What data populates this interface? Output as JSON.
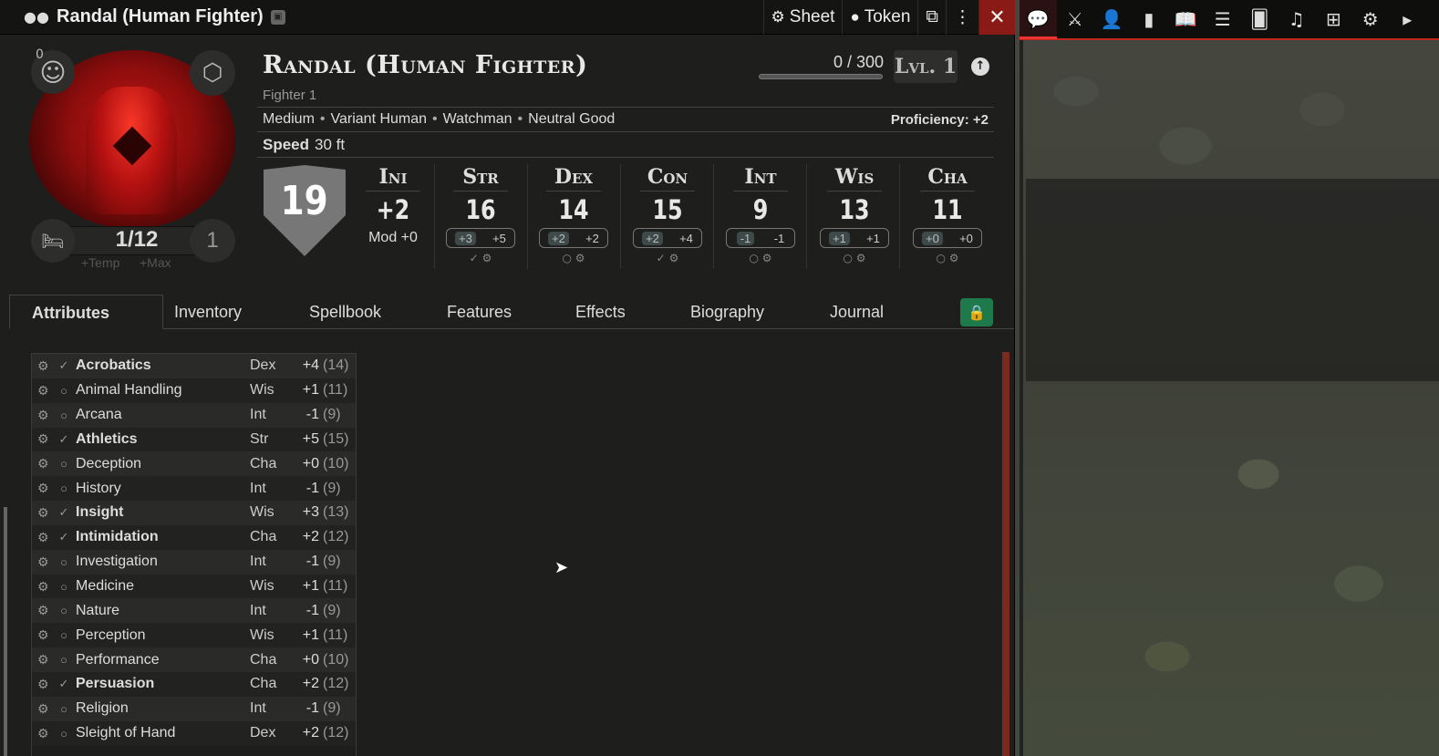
{
  "window": {
    "title": "Randal (Human Fighter)",
    "sheet_label": "Sheet",
    "token_label": "Token"
  },
  "character": {
    "name": "Randal (Human Fighter)",
    "class_level": "Fighter 1",
    "xp_text": "0 / 300",
    "level_label": "Lvl. 1",
    "info": [
      "Medium",
      "Variant Human",
      "Watchman",
      "Neutral Good"
    ],
    "proficiency": "Proficiency: +2",
    "speed_label": "Speed",
    "speed_value": "30 ft",
    "ac": "19",
    "hp": "1/12",
    "hit_dice": "1",
    "inspiration": "0",
    "temp_label": "+Temp",
    "max_label": "+Max"
  },
  "initiative": {
    "abbr": "Ini",
    "value": "+2",
    "mod_text": "Mod +0"
  },
  "abilities": [
    {
      "abbr": "Str",
      "score": "16",
      "mod": "+3",
      "save": "+5",
      "save_flag": "✓"
    },
    {
      "abbr": "Dex",
      "score": "14",
      "mod": "+2",
      "save": "+2",
      "save_flag": "○"
    },
    {
      "abbr": "Con",
      "score": "15",
      "mod": "+2",
      "save": "+4",
      "save_flag": "✓"
    },
    {
      "abbr": "Int",
      "score": "9",
      "mod": "-1",
      "save": "-1",
      "save_flag": "○"
    },
    {
      "abbr": "Wis",
      "score": "13",
      "mod": "+1",
      "save": "+1",
      "save_flag": "○"
    },
    {
      "abbr": "Cha",
      "score": "11",
      "mod": "+0",
      "save": "+0",
      "save_flag": "○"
    }
  ],
  "tabs": [
    "Attributes",
    "Inventory",
    "Spellbook",
    "Features",
    "Effects",
    "Biography",
    "Journal"
  ],
  "skills": [
    {
      "name": "Acrobatics",
      "abil": "Dex",
      "mod": "+4",
      "passive": "(14)",
      "prof": true
    },
    {
      "name": "Animal Handling",
      "abil": "Wis",
      "mod": "+1",
      "passive": "(11)",
      "prof": false
    },
    {
      "name": "Arcana",
      "abil": "Int",
      "mod": "-1",
      "passive": "(9)",
      "prof": false
    },
    {
      "name": "Athletics",
      "abil": "Str",
      "mod": "+5",
      "passive": "(15)",
      "prof": true
    },
    {
      "name": "Deception",
      "abil": "Cha",
      "mod": "+0",
      "passive": "(10)",
      "prof": false
    },
    {
      "name": "History",
      "abil": "Int",
      "mod": "-1",
      "passive": "(9)",
      "prof": false
    },
    {
      "name": "Insight",
      "abil": "Wis",
      "mod": "+3",
      "passive": "(13)",
      "prof": true
    },
    {
      "name": "Intimidation",
      "abil": "Cha",
      "mod": "+2",
      "passive": "(12)",
      "prof": true
    },
    {
      "name": "Investigation",
      "abil": "Int",
      "mod": "-1",
      "passive": "(9)",
      "prof": false
    },
    {
      "name": "Medicine",
      "abil": "Wis",
      "mod": "+1",
      "passive": "(11)",
      "prof": false
    },
    {
      "name": "Nature",
      "abil": "Int",
      "mod": "-1",
      "passive": "(9)",
      "prof": false
    },
    {
      "name": "Perception",
      "abil": "Wis",
      "mod": "+1",
      "passive": "(11)",
      "prof": false
    },
    {
      "name": "Performance",
      "abil": "Cha",
      "mod": "+0",
      "passive": "(10)",
      "prof": false
    },
    {
      "name": "Persuasion",
      "abil": "Cha",
      "mod": "+2",
      "passive": "(12)",
      "prof": true
    },
    {
      "name": "Religion",
      "abil": "Int",
      "mod": "-1",
      "passive": "(9)",
      "prof": false
    },
    {
      "name": "Sleight of Hand",
      "abil": "Dex",
      "mod": "+2",
      "passive": "(12)",
      "prof": false
    }
  ],
  "sidebar_icons": [
    "chat-icon",
    "combat-icon",
    "actors-icon",
    "items-icon",
    "journal-icon",
    "tables-icon",
    "cards-icon",
    "playlists-icon",
    "compendium-icon",
    "settings-icon",
    "collapse-icon"
  ],
  "colors": {
    "accent_red": "#c0281e",
    "lock_green": "#1e7a4a",
    "close_red": "#8a1a16"
  }
}
